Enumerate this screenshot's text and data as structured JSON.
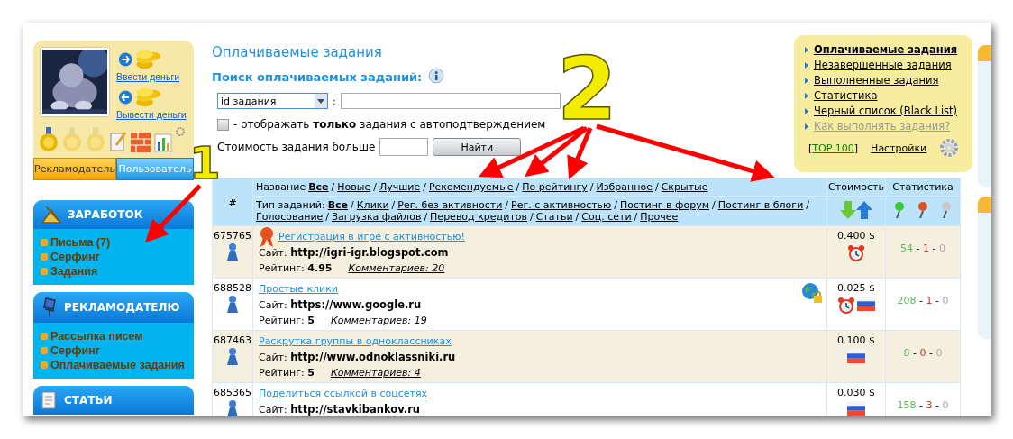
{
  "left_panel": {
    "money_links": [
      {
        "label": "Ввести деньги",
        "kind": "deposit"
      },
      {
        "label": "Вывести деньги",
        "kind": "withdraw"
      }
    ],
    "medals": [
      {
        "earned": true
      },
      {
        "earned": false
      },
      {
        "earned": false
      }
    ],
    "tabs": [
      {
        "label": "Рекламодатель",
        "selected": true
      },
      {
        "label": "Пользователь",
        "selected": false
      }
    ]
  },
  "sidebar": [
    {
      "title": "ЗАРАБОТОК",
      "kind": "earnings",
      "items": [
        "Письма (7)",
        "Серфинг",
        "Задания"
      ]
    },
    {
      "title": "РЕКЛАМОДАТЕЛЮ",
      "kind": "advertiser",
      "items": [
        "Рассылка писем",
        "Серфинг",
        "Оплачиваемые задания"
      ]
    },
    {
      "title": "СТАТЬИ",
      "kind": "articles"
    }
  ],
  "search": {
    "title": "Оплачиваемые задания",
    "search_label": "Поиск оплачиваемых заданий:",
    "select_value": "id задания",
    "colon": ":",
    "autoconfirm": {
      "checked": false,
      "text": "- отображать **только** задания с автоподтверждением"
    },
    "cost_label": "Стоимость задания больше",
    "button": "Найти"
  },
  "right_menu": {
    "items": [
      {
        "label": "Оплачиваемые задания",
        "current": true,
        "muted": false
      },
      {
        "label": "Незавершенные задания",
        "current": false,
        "muted": false
      },
      {
        "label": "Выполненные задания",
        "current": false,
        "muted": false
      },
      {
        "label": "Статистика",
        "current": false,
        "muted": false
      },
      {
        "label": "Черный список (Black List)",
        "current": false,
        "muted": false
      },
      {
        "label": "Как выполнять задания?",
        "current": false,
        "muted": true
      }
    ],
    "top": {
      "open": "[",
      "label": "TOP 100",
      "close": "]"
    },
    "settings": "Настройки"
  },
  "table": {
    "columns": [
      "#",
      "Стоимость",
      "Статистика"
    ],
    "separator": "/",
    "stats_separator": "-",
    "filters": [
      {
        "label": "Название",
        "links": [
          {
            "label": "Все",
            "selected": true
          },
          {
            "label": "Новые",
            "selected": false
          },
          {
            "label": "Лучшие",
            "selected": false
          },
          {
            "label": "Рекомендуемые",
            "selected": false
          },
          {
            "label": "По рейтингу",
            "selected": false
          },
          {
            "label": "Избранное",
            "selected": false
          },
          {
            "label": "Скрытые",
            "selected": false
          }
        ]
      },
      {
        "label": "Тип заданий:",
        "links": [
          {
            "label": "Все",
            "selected": true
          },
          {
            "label": "Клики",
            "selected": false
          },
          {
            "label": "Рег. без активности",
            "selected": false
          },
          {
            "label": "Рег. с активностью",
            "selected": false
          },
          {
            "label": "Постинг в форум",
            "selected": false
          },
          {
            "label": "Постинг в блоги",
            "selected": false
          },
          {
            "label": "Голосование",
            "selected": false
          },
          {
            "label": "Загрузка файлов",
            "selected": false
          },
          {
            "label": "Перевод кредитов",
            "selected": false
          },
          {
            "label": "Статьи",
            "selected": false
          },
          {
            "label": "Соц. сети",
            "selected": false
          },
          {
            "label": "Прочее",
            "selected": false
          }
        ]
      }
    ],
    "rows": [
      {
        "id": "675765",
        "title": "Регистрация в игре с активностью!",
        "award": true,
        "secure": false,
        "site_label": "Сайт:",
        "site": "http://igri-igr.blogspot.com",
        "rating_label": "Рейтинг:",
        "rating": "4.95",
        "comments": "Комментариев: 20",
        "price": "0.400 $",
        "badges": [
          {
            "kind": "clock"
          }
        ],
        "stats": [
          "54",
          "1",
          "0"
        ]
      },
      {
        "id": "688528",
        "title": "Простые клики",
        "award": false,
        "secure": true,
        "site_label": "Сайт:",
        "site": "https://www.google.ru",
        "rating_label": "Рейтинг:",
        "rating": "5",
        "comments": "Комментариев: 19",
        "price": "0.025 $",
        "badges": [
          {
            "kind": "clock"
          },
          {
            "kind": "flag"
          }
        ],
        "stats": [
          "208",
          "1",
          "0"
        ]
      },
      {
        "id": "687463",
        "title": "Раскрутка группы в одноклассниках",
        "award": false,
        "secure": false,
        "site_label": "Сайт:",
        "site": "http://www.odnoklassniki.ru",
        "rating_label": "Рейтинг:",
        "rating": "5",
        "comments": "Комментариев: 4",
        "price": "0.100 $",
        "badges": [
          {
            "kind": "flag"
          }
        ],
        "stats": [
          "8",
          "0",
          "0"
        ]
      },
      {
        "id": "685365",
        "title": "Поделиться ссылкой в соцсетях",
        "award": false,
        "secure": false,
        "site_label": "Сайт:",
        "site": "http://stavkibankov.ru",
        "price": "0.030 $",
        "badges": [
          {
            "kind": "flag"
          }
        ],
        "stats": [
          "158",
          "3",
          "0"
        ]
      }
    ]
  },
  "annotations": {
    "numbers": [
      "1",
      "2"
    ]
  }
}
